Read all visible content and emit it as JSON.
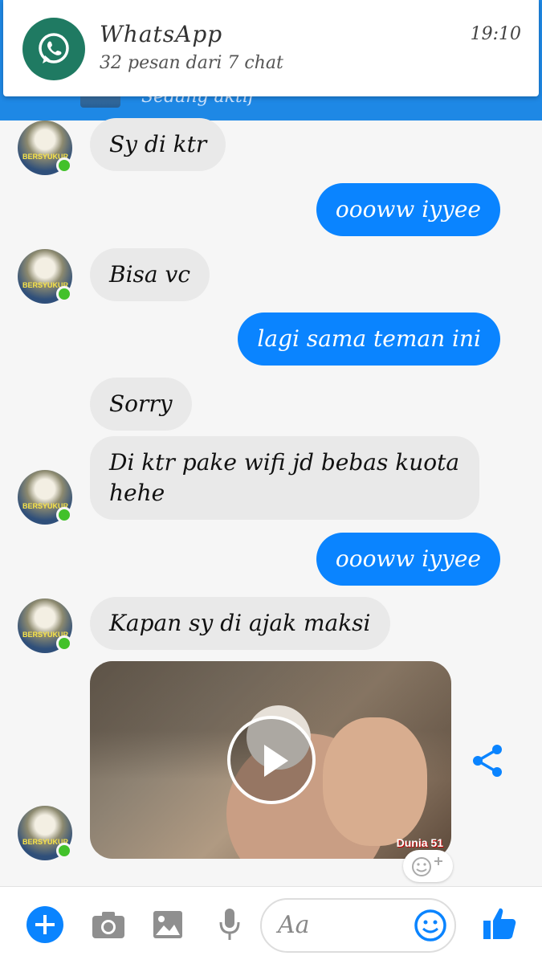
{
  "header": {
    "status_text": "Sedang aktif"
  },
  "notification": {
    "app_name": "WhatsApp",
    "time": "19:10",
    "summary": "32 pesan dari 7 chat"
  },
  "messages": [
    {
      "dir": "in",
      "text": "Sy di ktr"
    },
    {
      "dir": "out",
      "text": "oooww iyyee"
    },
    {
      "dir": "in",
      "text": "Bisa vc"
    },
    {
      "dir": "out",
      "text": "lagi sama teman ini"
    },
    {
      "dir": "in",
      "text": "Sorry"
    },
    {
      "dir": "in",
      "text": "Di ktr pake wifi jd bebas kuota hehe"
    },
    {
      "dir": "out",
      "text": "oooww iyyee"
    },
    {
      "dir": "in",
      "text": "Kapan sy di ajak maksi"
    }
  ],
  "avatar_caption": "BERSYUKUR",
  "video": {
    "watermark": "Dunia 51"
  },
  "composer": {
    "placeholder": "Aa"
  },
  "colors": {
    "accent": "#0a84ff",
    "header": "#1e88e5",
    "online": "#42c12a",
    "whatsapp": "#1f7a62"
  },
  "icons": [
    "whatsapp-icon",
    "play-icon",
    "share-icon",
    "add-reaction-icon",
    "plus-icon",
    "camera-icon",
    "gallery-icon",
    "microphone-icon",
    "emoji-icon",
    "like-icon"
  ]
}
